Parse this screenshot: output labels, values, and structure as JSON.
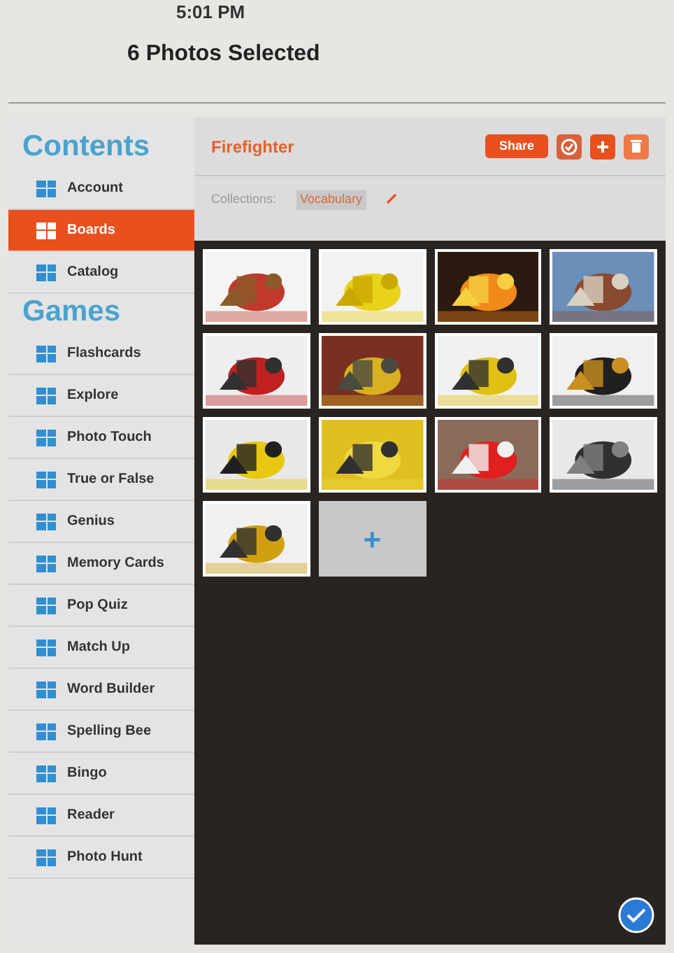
{
  "status_bar": {
    "time": "5:01 PM"
  },
  "header": {
    "title": "6 Photos Selected"
  },
  "sidebar": {
    "sections": [
      {
        "title": "Contents",
        "items": [
          {
            "label": "Account",
            "selected": false
          },
          {
            "label": "Boards",
            "selected": true
          },
          {
            "label": "Catalog",
            "selected": false
          }
        ]
      },
      {
        "title": "Games",
        "items": [
          {
            "label": "Flashcards",
            "selected": false
          },
          {
            "label": "Explore",
            "selected": false
          },
          {
            "label": "Photo Touch",
            "selected": false
          },
          {
            "label": "True or False",
            "selected": false
          },
          {
            "label": "Genius",
            "selected": false
          },
          {
            "label": "Memory Cards",
            "selected": false
          },
          {
            "label": "Pop Quiz",
            "selected": false
          },
          {
            "label": "Match Up",
            "selected": false
          },
          {
            "label": "Word Builder",
            "selected": false
          },
          {
            "label": "Spelling Bee",
            "selected": false
          },
          {
            "label": "Bingo",
            "selected": false
          },
          {
            "label": "Reader",
            "selected": false
          },
          {
            "label": "Photo Hunt",
            "selected": false
          }
        ]
      }
    ]
  },
  "board": {
    "title": "Firefighter",
    "share_button": "Share",
    "collections_label": "Collections:",
    "collection_tag": "Vocabulary",
    "tiles": [
      {
        "kind": "picture"
      },
      {
        "kind": "picture"
      },
      {
        "kind": "picture"
      },
      {
        "kind": "picture"
      },
      {
        "kind": "picture"
      },
      {
        "kind": "picture"
      },
      {
        "kind": "picture"
      },
      {
        "kind": "picture"
      },
      {
        "kind": "picture"
      },
      {
        "kind": "picture"
      },
      {
        "kind": "picture"
      },
      {
        "kind": "picture"
      },
      {
        "kind": "picture"
      },
      {
        "kind": "add",
        "label": "+"
      }
    ]
  }
}
